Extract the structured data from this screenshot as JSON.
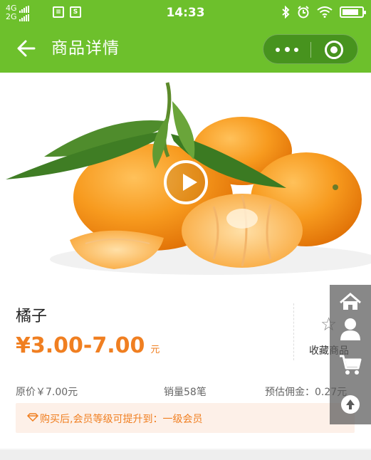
{
  "status_bar": {
    "network_top": "4G",
    "network_bottom": "2G",
    "time": "14:33",
    "battery_level": 0.85
  },
  "nav": {
    "title": "商品详情"
  },
  "product": {
    "name": "橘子",
    "price_range": "¥3.00-7.00",
    "price_unit": "元",
    "original_price": "原价￥7.00元",
    "sales": "销量58笔",
    "commission": "预估佣金：0.27元",
    "favorite_label": "收藏商品",
    "member_notice": "购买后,会员等级可提升到：一级会员"
  },
  "colors": {
    "brand_green": "#6dc02c",
    "price_orange": "#f07f21",
    "notice_bg": "#fdf0e8"
  },
  "icons": {
    "back": "back-arrow-icon",
    "more": "more-dots-icon",
    "close": "close-miniprogram-icon",
    "play": "play-icon",
    "favorite": "star-icon",
    "home": "home-icon",
    "user": "user-icon",
    "cart": "cart-icon",
    "to_top": "back-to-top-icon",
    "notice": "diamond-icon"
  }
}
